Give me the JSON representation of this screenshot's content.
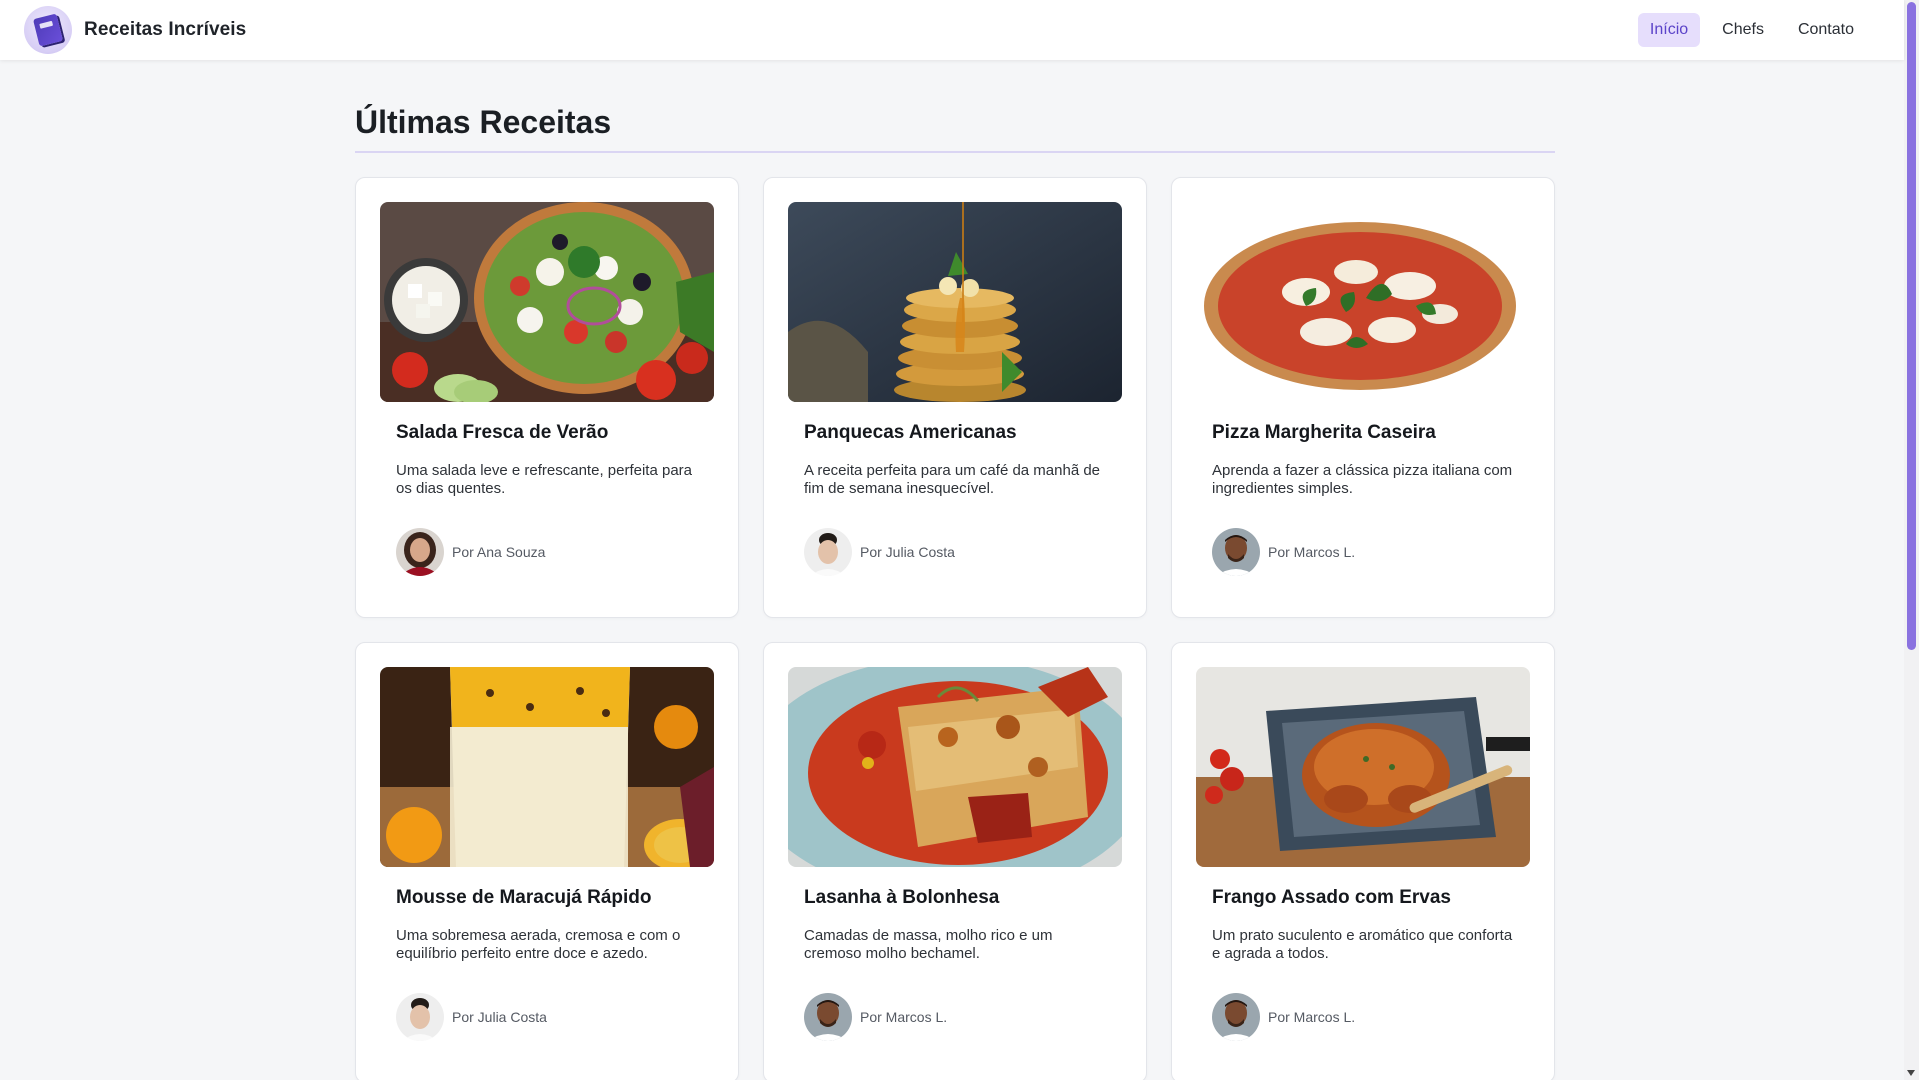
{
  "app": {
    "brand_title": "Receitas Incríveis",
    "logo_icon": "recipe-book-icon",
    "accent_color": "#6a4fd9"
  },
  "nav": {
    "items": [
      {
        "label": "Início",
        "active": true
      },
      {
        "label": "Chefs",
        "active": false
      },
      {
        "label": "Contato",
        "active": false
      }
    ]
  },
  "main": {
    "section_title": "Últimas Receitas",
    "recipes": [
      {
        "title": "Salada Fresca de Verão",
        "description": "Uma salada leve e refrescante, perfeita para os dias quentes.",
        "author": "Por Ana Souza",
        "image_icon": "salad-photo",
        "avatar_icon": "chef-ana-avatar"
      },
      {
        "title": "Panquecas Americanas",
        "description": "A receita perfeita para um café da manhã de fim de semana inesquecível.",
        "author": "Por Julia Costa",
        "image_icon": "pancakes-photo",
        "avatar_icon": "chef-julia-avatar"
      },
      {
        "title": "Pizza Margherita Caseira",
        "description": "Aprenda a fazer a clássica pizza italiana com ingredientes simples.",
        "author": "Por Marcos L.",
        "image_icon": "pizza-photo",
        "avatar_icon": "chef-marcos-avatar"
      },
      {
        "title": "Mousse de Maracujá Rápido",
        "description": "Uma sobremesa aerada, cremosa e com o equilíbrio perfeito entre doce e azedo.",
        "author": "Por Julia Costa",
        "image_icon": "mousse-photo",
        "avatar_icon": "chef-julia-avatar"
      },
      {
        "title": "Lasanha à Bolonhesa",
        "description": "Camadas de massa, molho rico e um cremoso molho bechamel.",
        "author": "Por Marcos L.",
        "image_icon": "lasagna-photo",
        "avatar_icon": "chef-marcos-avatar"
      },
      {
        "title": "Frango Assado com Ervas",
        "description": "Um prato suculento e aromático que conforta e agrada a todos.",
        "author": "Por Marcos L.",
        "image_icon": "roast-chicken-photo",
        "avatar_icon": "chef-marcos-avatar"
      }
    ]
  }
}
